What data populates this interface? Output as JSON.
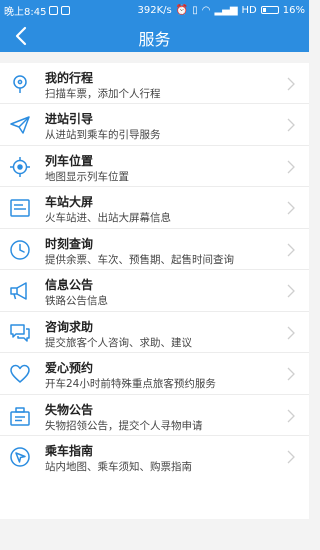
{
  "status_bar": {
    "time": "晚上8:45",
    "speed": "392K/s",
    "network": "HD",
    "battery": "16%"
  },
  "header": {
    "title": "服务"
  },
  "items": [
    {
      "title": "我的行程",
      "subtitle": "扫描车票，添加个人行程",
      "icon": "location-pin-icon"
    },
    {
      "title": "进站引导",
      "subtitle": "从进站到乘车的引导服务",
      "icon": "paper-plane-icon"
    },
    {
      "title": "列车位置",
      "subtitle": "地图显示列车位置",
      "icon": "crosshair-icon"
    },
    {
      "title": "车站大屏",
      "subtitle": "火车站进、出站大屏幕信息",
      "icon": "screen-icon"
    },
    {
      "title": "时刻查询",
      "subtitle": "提供余票、车次、预售期、起售时间查询",
      "icon": "clock-icon"
    },
    {
      "title": "信息公告",
      "subtitle": "铁路公告信息",
      "icon": "megaphone-icon"
    },
    {
      "title": "咨询求助",
      "subtitle": "提交旅客个人咨询、求助、建议",
      "icon": "chat-bubbles-icon"
    },
    {
      "title": "爱心预约",
      "subtitle": "开车24小时前特殊重点旅客预约服务",
      "icon": "heart-icon"
    },
    {
      "title": "失物公告",
      "subtitle": "失物招领公告，提交个人寻物申请",
      "icon": "lost-found-box-icon"
    },
    {
      "title": "乘车指南",
      "subtitle": "站内地图、乘车须知、购票指南",
      "icon": "compass-navigation-icon"
    }
  ],
  "colors": {
    "brand": "#2c8de0",
    "background": "#f3f3f3",
    "icon": "#2c8de0"
  }
}
